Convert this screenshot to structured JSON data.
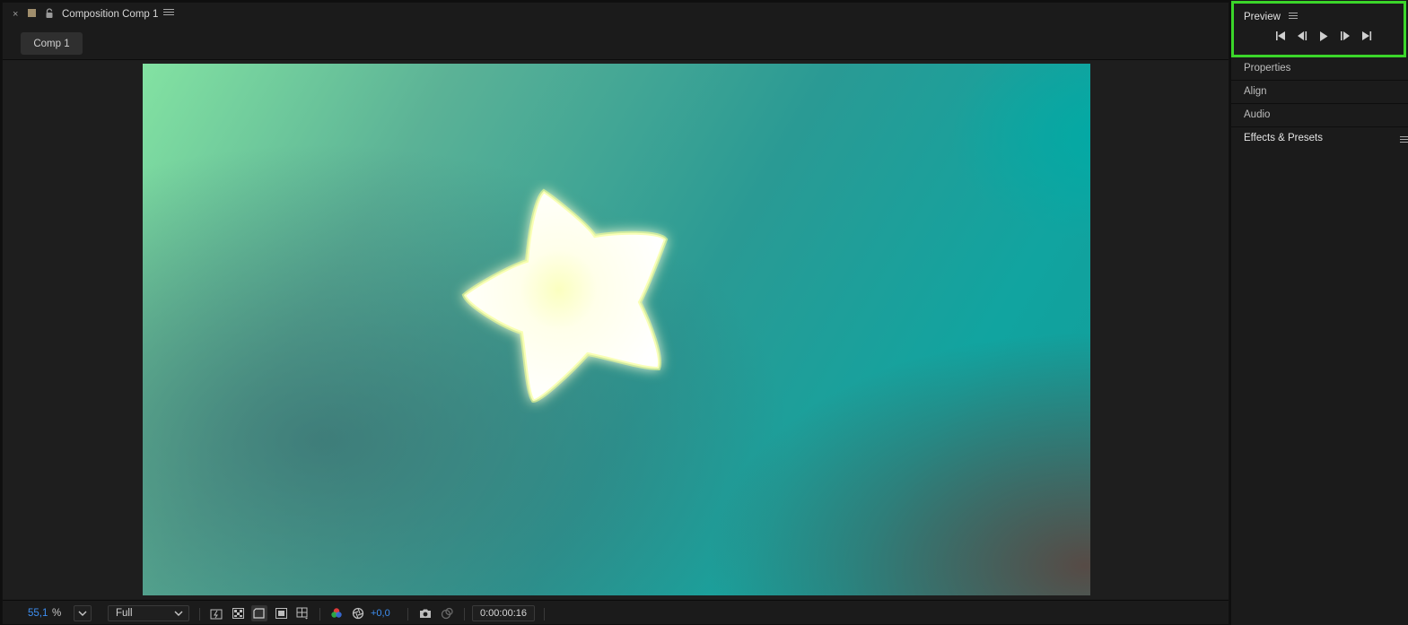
{
  "composition_panel": {
    "title": "Composition Comp 1",
    "tab_label": "Comp 1",
    "close_glyph": "×"
  },
  "toolbar": {
    "zoom_value": "55,1",
    "zoom_unit": "%",
    "resolution": "Full",
    "exposure": "+0,0",
    "timecode": "0:00:00:16"
  },
  "right_panels": {
    "preview": {
      "title": "Preview",
      "highlight_color": "#3bd62a"
    },
    "properties": "Properties",
    "align": "Align",
    "audio": "Audio",
    "effects": "Effects & Presets"
  },
  "colors": {
    "accent_blue": "#3d8ef0",
    "label_chip": "#a08e6c"
  }
}
